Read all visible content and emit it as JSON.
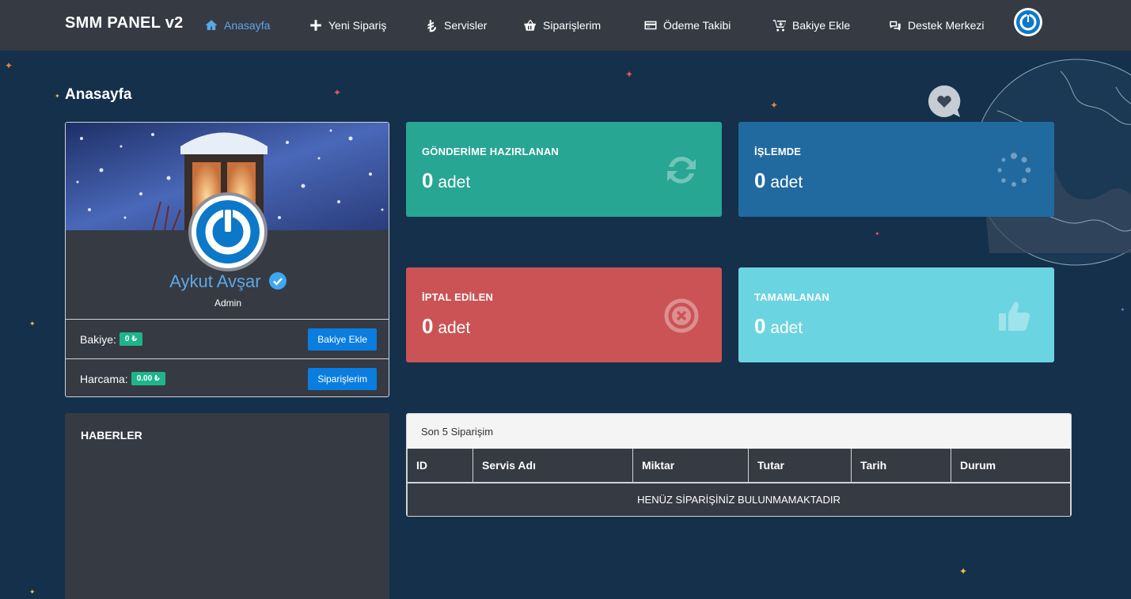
{
  "navbar": {
    "brand": "SMM PANEL v2",
    "items": [
      {
        "label": "Anasayfa",
        "icon": "home-icon",
        "active": true
      },
      {
        "label": "Yeni Sipariş",
        "icon": "plus-icon"
      },
      {
        "label": "Servisler",
        "icon": "lira-icon"
      },
      {
        "label": "Siparişlerim",
        "icon": "basket-icon"
      },
      {
        "label": "Ödeme Takibi",
        "icon": "credit-card-icon"
      },
      {
        "label": "Bakiye Ekle",
        "icon": "cart-plus-icon"
      },
      {
        "label": "Destek Merkezi",
        "icon": "chat-icon"
      }
    ]
  },
  "page": {
    "title": "Anasayfa"
  },
  "profile": {
    "name": "Aykut Avşar",
    "role": "Admin",
    "balance_label": "Bakiye:",
    "balance_value": "0 ₺",
    "balance_button": "Bakiye Ekle",
    "spend_label": "Harcama:",
    "spend_value": "0.00 ₺",
    "spend_button": "Siparişlerim"
  },
  "stats": [
    {
      "label": "GÖNDERİME HAZIRLANAN",
      "count": "0",
      "unit": "adet",
      "color": "#26a693",
      "icon": "refresh-icon"
    },
    {
      "label": "İŞLEMDE",
      "count": "0",
      "unit": "adet",
      "color": "#216a9f",
      "icon": "spinner-icon"
    },
    {
      "label": "İPTAL EDİLEN",
      "count": "0",
      "unit": "adet",
      "color": "#cb5355",
      "icon": "times-circle-icon"
    },
    {
      "label": "TAMAMLANAN",
      "count": "0",
      "unit": "adet",
      "color": "#6bd4e1",
      "icon": "thumbs-up-icon"
    }
  ],
  "news": {
    "title": "HABERLER"
  },
  "orders": {
    "title": "Son 5 Siparişim",
    "columns": [
      "ID",
      "Servis Adı",
      "Miktar",
      "Tutar",
      "Tarih",
      "Durum"
    ],
    "empty_text": "HENÜZ SİPARİŞİNİZ BULUNMAMAKTADIR"
  }
}
